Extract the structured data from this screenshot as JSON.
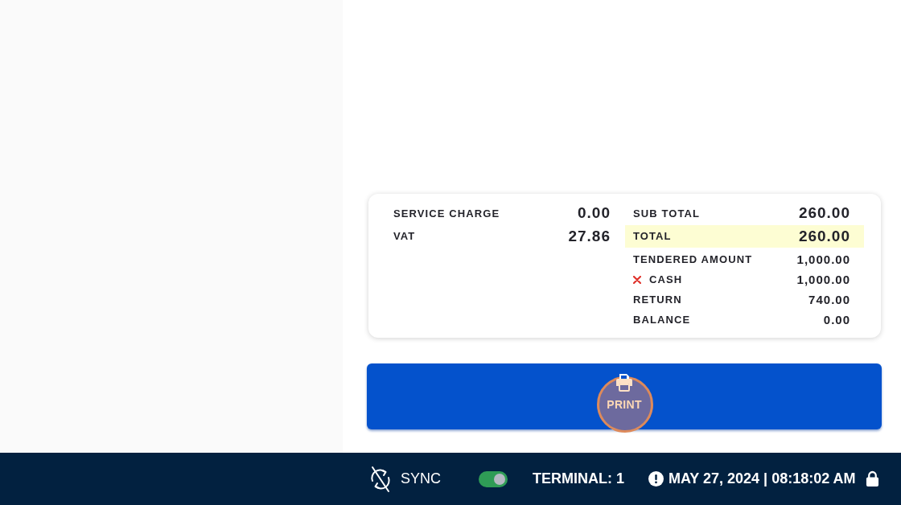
{
  "summary": {
    "left_rows": [
      {
        "label": "SERVICE CHARGE",
        "value": "0.00"
      },
      {
        "label": "VAT",
        "value": "27.86"
      }
    ],
    "right_rows": [
      {
        "kind": "subtotal",
        "label": "SUB TOTAL",
        "value": "260.00"
      },
      {
        "kind": "total",
        "label": "TOTAL",
        "value": "260.00"
      },
      {
        "kind": "detail",
        "label": "TENDERED AMOUNT",
        "value": "1,000.00"
      },
      {
        "kind": "payment",
        "label": "CASH",
        "value": "1,000.00"
      },
      {
        "kind": "detail",
        "label": "RETURN",
        "value": "740.00"
      },
      {
        "kind": "detail",
        "label": "BALANCE",
        "value": "0.00"
      }
    ]
  },
  "print_button": {
    "label": "PRINT"
  },
  "status_bar": {
    "sync_label": "SYNC",
    "sync_toggle": {
      "on": true
    },
    "terminal": "TERMINAL: 1",
    "datetime": "MAY 27, 2024 | 08:18:02 AM"
  }
}
